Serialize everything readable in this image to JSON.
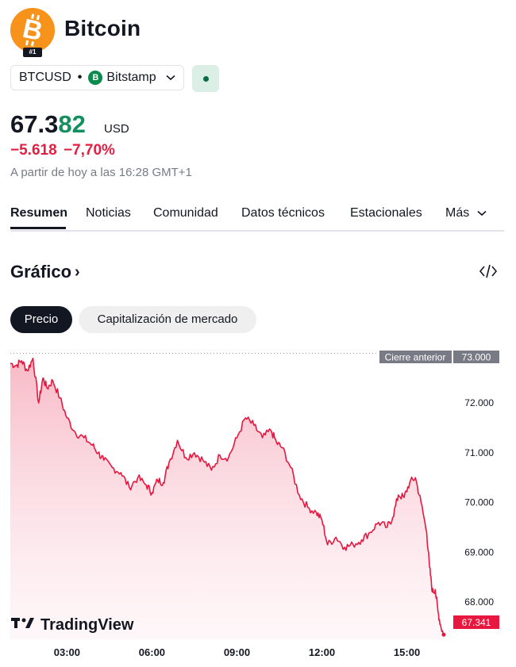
{
  "header": {
    "title": "Bitcoin",
    "rank": "#1",
    "logo_icon": "bitcoin-logo-icon",
    "symbol": "BTCUSD",
    "separator": "•",
    "exchange": "Bitstamp",
    "market_status_icon": "market-open-dot-icon"
  },
  "price": {
    "main": "67.3",
    "highlight": "82",
    "currency": "USD",
    "change": "−5.618",
    "change_pct": "−7,70%",
    "timestamp": "A partir de hoy a las 16:28 GMT+1"
  },
  "tabs": [
    {
      "label": "Resumen",
      "active": true
    },
    {
      "label": "Noticias"
    },
    {
      "label": "Comunidad"
    },
    {
      "label": "Datos técnicos"
    },
    {
      "label": "Estacionales"
    },
    {
      "label": "Más"
    }
  ],
  "chart_section": {
    "title": "Gráfico",
    "chevron": "›",
    "embed_icon": "code-embed-icon",
    "pills": [
      "Precio",
      "Capitalización de mercado"
    ],
    "brand": "TradingView",
    "prev_close_label": "Cierre anterior",
    "prev_close_value": "73.000",
    "last_value_label": "67.341"
  },
  "colors": {
    "accent_green": "#168f60",
    "negative_red": "#e02043",
    "bitcoin_orange": "#f7931a",
    "line_color": "#e8173f"
  },
  "chart_data": {
    "type": "area",
    "x_ticks": [
      "03:00",
      "06:00",
      "09:00",
      "12:00",
      "15:00"
    ],
    "x_tick_hours": [
      3,
      6,
      9,
      12,
      15
    ],
    "y_ticks": [
      "72.000",
      "71.000",
      "70.000",
      "69.000",
      "68.000"
    ],
    "y_tick_values": [
      72000,
      71000,
      70000,
      69000,
      68000
    ],
    "ylim": [
      67250,
      73150
    ],
    "xlim_hours": [
      1.0,
      16.47
    ],
    "previous_close": 73000,
    "last_value": 67341,
    "x": [
      1.0,
      1.2,
      1.4,
      1.6,
      1.8,
      2.0,
      2.15,
      2.3,
      2.5,
      2.75,
      3.0,
      3.3,
      3.6,
      3.9,
      4.1,
      4.3,
      4.6,
      4.9,
      5.2,
      5.5,
      5.8,
      6.0,
      6.2,
      6.4,
      6.6,
      6.9,
      7.2,
      7.5,
      7.8,
      8.1,
      8.4,
      8.7,
      9.0,
      9.3,
      9.6,
      9.9,
      10.2,
      10.4,
      10.6,
      10.9,
      11.2,
      11.5,
      11.8,
      12.0,
      12.2,
      12.5,
      12.8,
      13.1,
      13.4,
      13.7,
      14.0,
      14.3,
      14.5,
      14.7,
      14.9,
      15.1,
      15.3,
      15.5,
      15.7,
      15.8,
      15.9,
      16.0,
      16.1,
      16.2,
      16.3
    ],
    "y": [
      72800,
      72750,
      72850,
      72650,
      72900,
      72000,
      72500,
      72300,
      72450,
      72100,
      71700,
      71400,
      71300,
      71150,
      71000,
      70850,
      70700,
      70600,
      70300,
      70500,
      70350,
      70200,
      70450,
      70400,
      70800,
      71250,
      70900,
      71000,
      70850,
      70650,
      70950,
      70900,
      71300,
      71700,
      71550,
      71300,
      71450,
      71200,
      71100,
      70700,
      70150,
      69900,
      69800,
      69650,
      69150,
      69300,
      69100,
      69150,
      69250,
      69400,
      69600,
      69500,
      69700,
      70150,
      70100,
      70400,
      70500,
      70000,
      69400,
      68700,
      68200,
      68250,
      67800,
      67500,
      67341
    ]
  }
}
